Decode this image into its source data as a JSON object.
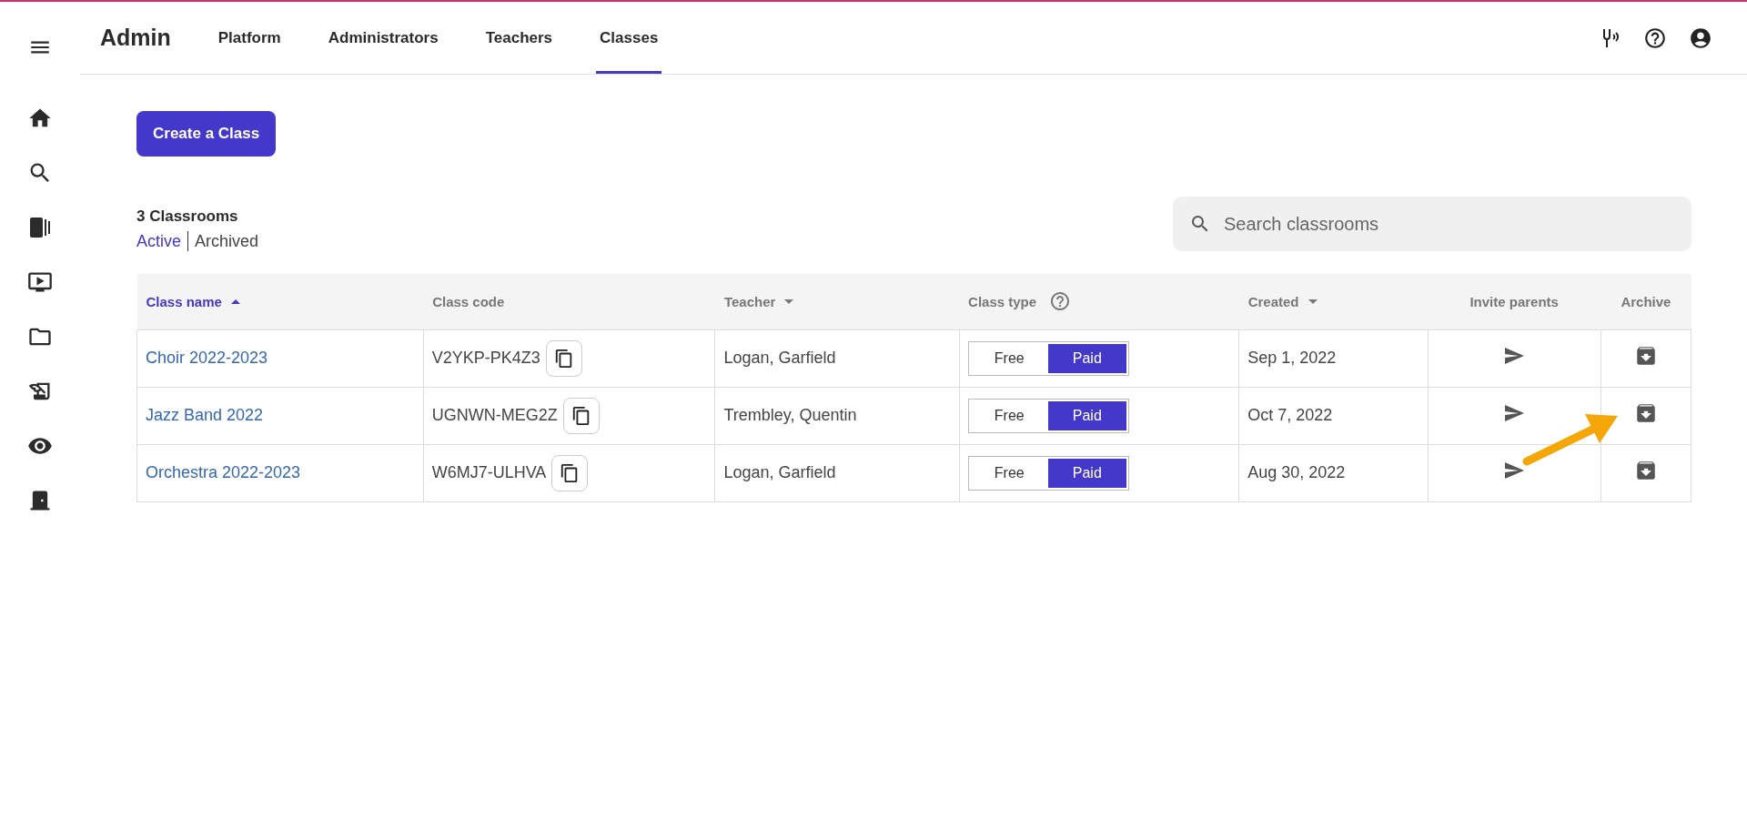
{
  "app_title": "Admin",
  "tabs": [
    {
      "label": "Platform",
      "selected": false
    },
    {
      "label": "Administrators",
      "selected": false
    },
    {
      "label": "Teachers",
      "selected": false
    },
    {
      "label": "Classes",
      "selected": true
    }
  ],
  "create_button": "Create a Class",
  "count": "3 Classrooms",
  "filters": [
    {
      "label": "Active",
      "selected": true
    },
    {
      "label": "Archived",
      "selected": false
    }
  ],
  "search": {
    "placeholder": "Search classrooms"
  },
  "table": {
    "columns": [
      {
        "label": "Class name",
        "sortable": true,
        "ascending": true,
        "active": true
      },
      {
        "label": "Class code",
        "sortable": false,
        "active": false
      },
      {
        "label": "Teacher",
        "sortable": true,
        "ascending": false,
        "active": false
      },
      {
        "label": "Class type",
        "sortable": false,
        "active": false,
        "help": true
      },
      {
        "label": "Created",
        "sortable": true,
        "ascending": false,
        "active": false
      },
      {
        "label": "Invite parents",
        "sortable": false,
        "active": false
      },
      {
        "label": "Archive",
        "sortable": false,
        "active": false
      }
    ],
    "rows": [
      {
        "name": "Choir 2022-2023",
        "code": "V2YKP-PK4Z3",
        "teacher": "Logan, Garfield",
        "class_type": [
          {
            "label": "Free",
            "selected": false
          },
          {
            "label": "Paid",
            "selected": true
          }
        ],
        "created": "Sep 1, 2022"
      },
      {
        "name": "Jazz Band 2022",
        "code": "UGNWN-MEG2Z",
        "teacher": "Trembley, Quentin",
        "class_type": [
          {
            "label": "Free",
            "selected": false
          },
          {
            "label": "Paid",
            "selected": true
          }
        ],
        "created": "Oct 7, 2022"
      },
      {
        "name": "Orchestra 2022-2023",
        "code": "W6MJ7-ULHVA",
        "teacher": "Logan, Garfield",
        "class_type": [
          {
            "label": "Free",
            "selected": false
          },
          {
            "label": "Paid",
            "selected": true
          }
        ],
        "created": "Aug 30, 2022"
      }
    ]
  }
}
